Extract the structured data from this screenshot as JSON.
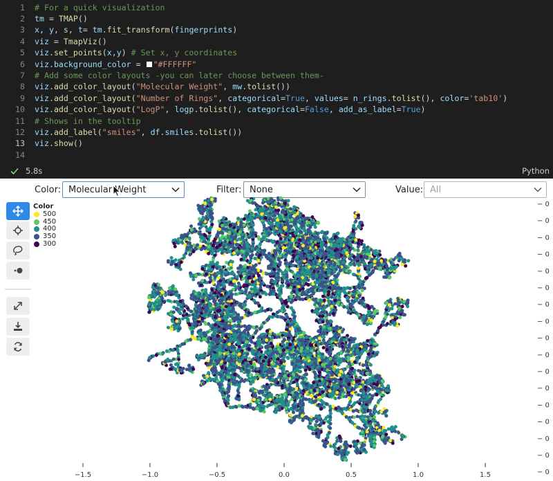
{
  "code": {
    "lines": [
      {
        "n": "1",
        "tokens": [
          {
            "c": "c",
            "t": "# For a quick visualization"
          }
        ]
      },
      {
        "n": "2",
        "tokens": [
          {
            "c": "v",
            "t": "tm"
          },
          {
            "c": "op",
            "t": " = "
          },
          {
            "c": "f",
            "t": "TMAP"
          },
          {
            "c": "op",
            "t": "()"
          }
        ]
      },
      {
        "n": "3",
        "tokens": [
          {
            "c": "v",
            "t": "x"
          },
          {
            "c": "op",
            "t": ", "
          },
          {
            "c": "v",
            "t": "y"
          },
          {
            "c": "op",
            "t": ", "
          },
          {
            "c": "v",
            "t": "s"
          },
          {
            "c": "op",
            "t": ", "
          },
          {
            "c": "v",
            "t": "t"
          },
          {
            "c": "op",
            "t": "= "
          },
          {
            "c": "v",
            "t": "tm"
          },
          {
            "c": "op",
            "t": "."
          },
          {
            "c": "f",
            "t": "fit_transform"
          },
          {
            "c": "op",
            "t": "("
          },
          {
            "c": "v",
            "t": "fingerprints"
          },
          {
            "c": "op",
            "t": ")"
          }
        ]
      },
      {
        "n": "4",
        "tokens": [
          {
            "c": "v",
            "t": "viz"
          },
          {
            "c": "op",
            "t": " = "
          },
          {
            "c": "f",
            "t": "TmapViz"
          },
          {
            "c": "op",
            "t": "()"
          }
        ]
      },
      {
        "n": "5",
        "tokens": [
          {
            "c": "v",
            "t": "viz"
          },
          {
            "c": "op",
            "t": "."
          },
          {
            "c": "f",
            "t": "set_points"
          },
          {
            "c": "op",
            "t": "("
          },
          {
            "c": "v",
            "t": "x"
          },
          {
            "c": "op",
            "t": ","
          },
          {
            "c": "v",
            "t": "y"
          },
          {
            "c": "op",
            "t": ") "
          },
          {
            "c": "c",
            "t": "# Set x, y coordinates"
          }
        ]
      },
      {
        "n": "6",
        "tokens": [
          {
            "c": "v",
            "t": "viz"
          },
          {
            "c": "op",
            "t": "."
          },
          {
            "c": "v",
            "t": "background_color"
          },
          {
            "c": "op",
            "t": " = "
          },
          {
            "c": "swatch",
            "t": ""
          },
          {
            "c": "s",
            "t": "\"#FFFFFF\""
          }
        ]
      },
      {
        "n": "7",
        "tokens": [
          {
            "c": "c",
            "t": "# Add some color layouts -you can later choose between them-"
          }
        ]
      },
      {
        "n": "8",
        "tokens": [
          {
            "c": "v",
            "t": "viz"
          },
          {
            "c": "op",
            "t": "."
          },
          {
            "c": "f",
            "t": "add_color_layout"
          },
          {
            "c": "op",
            "t": "("
          },
          {
            "c": "s",
            "t": "\"Molecular Weight\""
          },
          {
            "c": "op",
            "t": ", "
          },
          {
            "c": "v",
            "t": "mw"
          },
          {
            "c": "op",
            "t": "."
          },
          {
            "c": "f",
            "t": "tolist"
          },
          {
            "c": "op",
            "t": "())"
          }
        ]
      },
      {
        "n": "9",
        "tokens": [
          {
            "c": "v",
            "t": "viz"
          },
          {
            "c": "op",
            "t": "."
          },
          {
            "c": "f",
            "t": "add_color_layout"
          },
          {
            "c": "op",
            "t": "("
          },
          {
            "c": "s",
            "t": "\"Number of Rings\""
          },
          {
            "c": "op",
            "t": ", "
          },
          {
            "c": "v",
            "t": "categorical"
          },
          {
            "c": "op",
            "t": "="
          },
          {
            "c": "k",
            "t": "True"
          },
          {
            "c": "op",
            "t": ", "
          },
          {
            "c": "v",
            "t": "values"
          },
          {
            "c": "op",
            "t": "= "
          },
          {
            "c": "v",
            "t": "n_rings"
          },
          {
            "c": "op",
            "t": "."
          },
          {
            "c": "f",
            "t": "tolist"
          },
          {
            "c": "op",
            "t": "(), "
          },
          {
            "c": "v",
            "t": "color"
          },
          {
            "c": "op",
            "t": "="
          },
          {
            "c": "s",
            "t": "'tab10'"
          },
          {
            "c": "op",
            "t": ")"
          }
        ]
      },
      {
        "n": "10",
        "tokens": [
          {
            "c": "v",
            "t": "viz"
          },
          {
            "c": "op",
            "t": "."
          },
          {
            "c": "f",
            "t": "add_color_layout"
          },
          {
            "c": "op",
            "t": "("
          },
          {
            "c": "s",
            "t": "\"LogP\""
          },
          {
            "c": "op",
            "t": ", "
          },
          {
            "c": "v",
            "t": "logp"
          },
          {
            "c": "op",
            "t": "."
          },
          {
            "c": "f",
            "t": "tolist"
          },
          {
            "c": "op",
            "t": "(), "
          },
          {
            "c": "v",
            "t": "categorical"
          },
          {
            "c": "op",
            "t": "="
          },
          {
            "c": "k",
            "t": "False"
          },
          {
            "c": "op",
            "t": ", "
          },
          {
            "c": "v",
            "t": "add_as_label"
          },
          {
            "c": "op",
            "t": "="
          },
          {
            "c": "k",
            "t": "True"
          },
          {
            "c": "op",
            "t": ")"
          }
        ]
      },
      {
        "n": "11",
        "tokens": [
          {
            "c": "c",
            "t": "# Shows in the tooltip"
          }
        ]
      },
      {
        "n": "12",
        "tokens": [
          {
            "c": "v",
            "t": "viz"
          },
          {
            "c": "op",
            "t": "."
          },
          {
            "c": "f",
            "t": "add_label"
          },
          {
            "c": "op",
            "t": "("
          },
          {
            "c": "s",
            "t": "\"smiles\""
          },
          {
            "c": "op",
            "t": ", "
          },
          {
            "c": "v",
            "t": "df"
          },
          {
            "c": "op",
            "t": "."
          },
          {
            "c": "v",
            "t": "smiles"
          },
          {
            "c": "op",
            "t": "."
          },
          {
            "c": "f",
            "t": "tolist"
          },
          {
            "c": "op",
            "t": "())"
          }
        ]
      },
      {
        "n": "13",
        "tokens": [
          {
            "c": "v",
            "t": "viz"
          },
          {
            "c": "op",
            "t": "."
          },
          {
            "c": "f",
            "t": "show"
          },
          {
            "c": "op",
            "t": "()"
          }
        ]
      },
      {
        "n": "14",
        "tokens": []
      }
    ],
    "active_line": "13"
  },
  "status": {
    "exec_time": "5.8s",
    "language": "Python",
    "check_color": "#89d185"
  },
  "controls": {
    "color_label": "Color:",
    "color_value": "Molecular Weight",
    "filter_label": "Filter:",
    "filter_value": "None",
    "value_label": "Value:",
    "value_value": "All"
  },
  "toolbar": {
    "tools": [
      {
        "name": "pan-tool",
        "icon": "pan-icon",
        "active": true
      },
      {
        "name": "box-zoom-tool",
        "icon": "crosshair-icon",
        "active": false
      },
      {
        "name": "lasso-select-tool",
        "icon": "lasso-icon",
        "active": false
      },
      {
        "name": "point-size-tool",
        "icon": "point-size-icon",
        "active": false
      },
      {
        "name": "fullscreen-tool",
        "icon": "expand-icon",
        "active": false
      },
      {
        "name": "download-tool",
        "icon": "download-icon",
        "active": false
      },
      {
        "name": "reset-tool",
        "icon": "refresh-icon",
        "active": false
      }
    ],
    "accent": "#2e8ae6"
  },
  "legend": {
    "title": "Color",
    "items": [
      {
        "label": "500",
        "color": "#fde725"
      },
      {
        "label": "450",
        "color": "#5ec962"
      },
      {
        "label": "400",
        "color": "#21918c"
      },
      {
        "label": "350",
        "color": "#3b528b"
      },
      {
        "label": "300",
        "color": "#440154"
      }
    ]
  },
  "chart_data": {
    "type": "scatter",
    "description_series": "Molecular Weight",
    "x_ticks": [
      "−1.5",
      "−1.0",
      "−0.5",
      "0.0",
      "0.5",
      "1.0",
      "1.5"
    ],
    "y_ticks": [
      "− 0",
      "− 0",
      "− 0",
      "− 0",
      "− 0",
      "− 0",
      "− 0",
      "− 0",
      "− 0",
      "− 0",
      "− 0",
      "− 0",
      "− 0",
      "− 0",
      "− 0",
      "− 0",
      "− 0"
    ],
    "xlim": [
      -1.5,
      1.5
    ],
    "colormap": [
      "#440154",
      "#3b528b",
      "#21918c",
      "#5ec962",
      "#fde725"
    ],
    "value_range": [
      300,
      500
    ],
    "grid": false,
    "legend": "top-left"
  }
}
